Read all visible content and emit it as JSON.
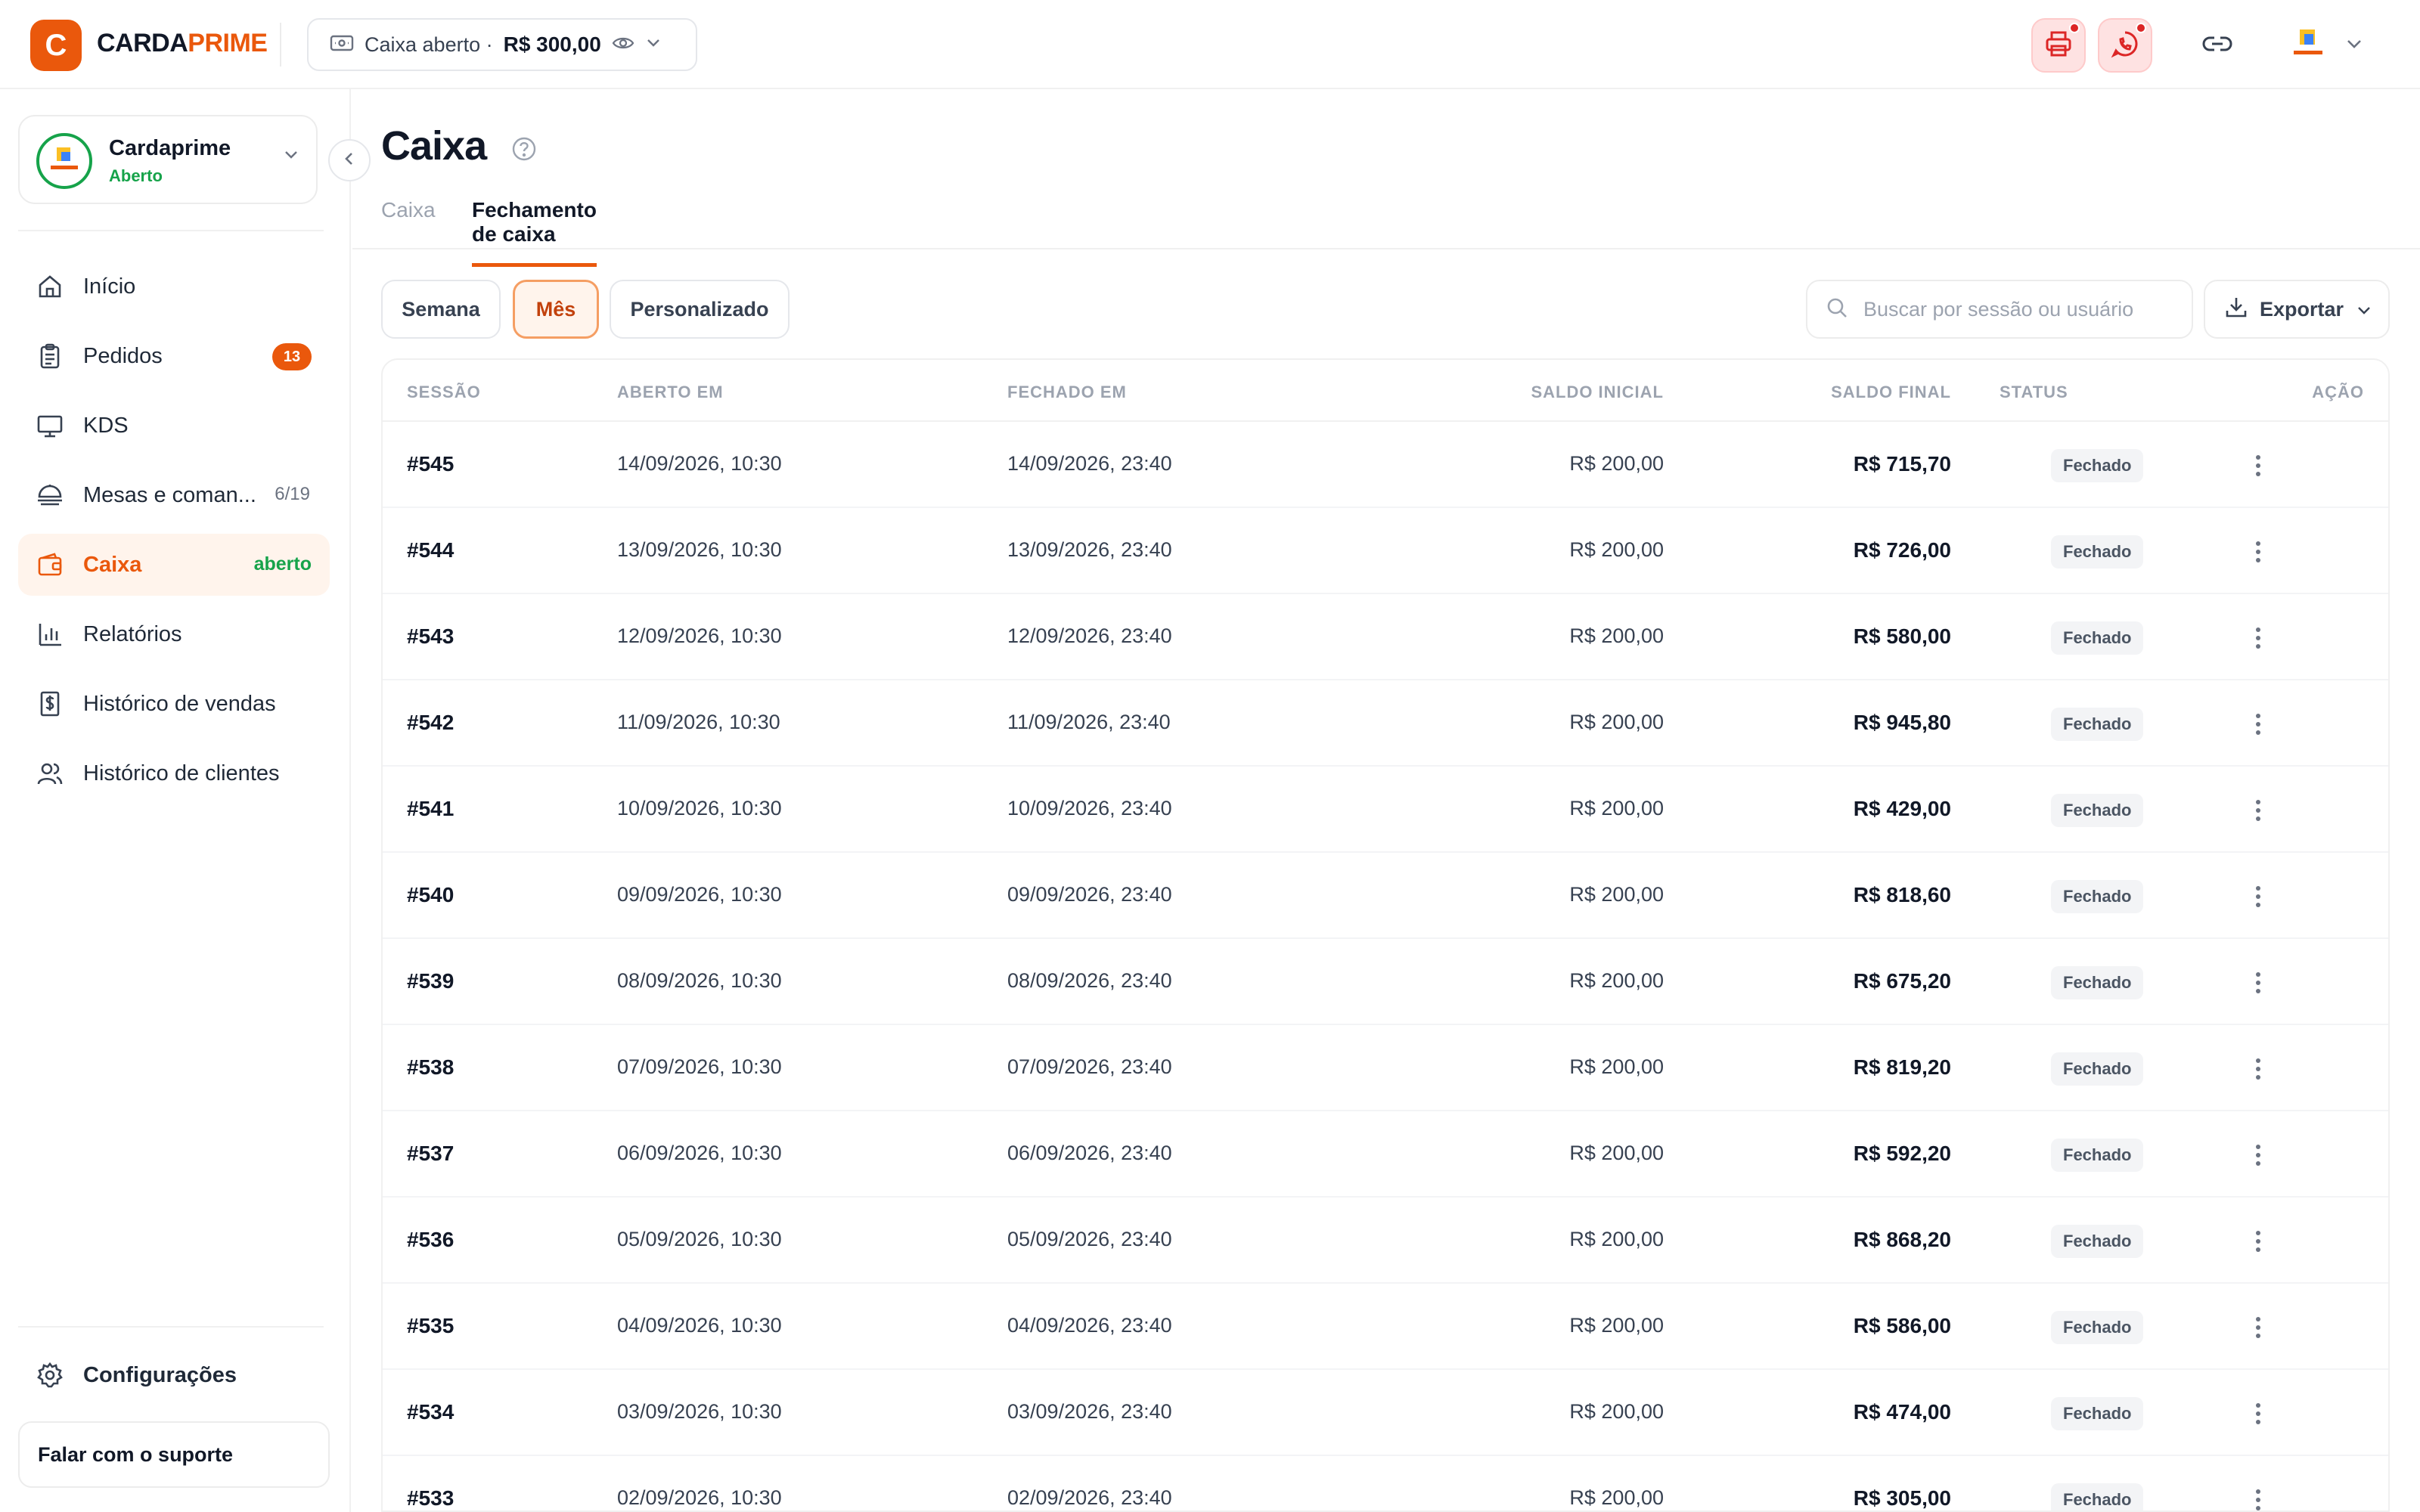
{
  "brand": {
    "mark": "C",
    "name_part1": "CARDA",
    "name_part2": "PRIME"
  },
  "cash_status": {
    "label": "Caixa aberto ·",
    "amount": "R$ 300,00"
  },
  "store": {
    "name": "Cardaprime",
    "status": "Aberto"
  },
  "nav": {
    "items": [
      {
        "label": "Início",
        "icon": "home-icon"
      },
      {
        "label": "Pedidos",
        "icon": "clipboard-icon",
        "badge": "13"
      },
      {
        "label": "KDS",
        "icon": "monitor-icon"
      },
      {
        "label": "Mesas e coman...",
        "icon": "dish-icon",
        "count": "6/19"
      },
      {
        "label": "Caixa",
        "icon": "wallet-icon",
        "tag": "aberto",
        "active": true
      },
      {
        "label": "Relatórios",
        "icon": "bar-chart-icon"
      },
      {
        "label": "Histórico de vendas",
        "icon": "receipt-dollar-icon"
      },
      {
        "label": "Histórico de clientes",
        "icon": "users-icon"
      }
    ],
    "settings": "Configurações",
    "support": "Falar com o suporte"
  },
  "page": {
    "title": "Caixa",
    "tabs": [
      "Caixa",
      "Fechamento de caixa"
    ],
    "active_tab": "Fechamento de caixa"
  },
  "filters": {
    "periods": [
      "Semana",
      "Mês",
      "Personalizado"
    ],
    "active_period": "Mês",
    "search_placeholder": "Buscar por sessão ou usuário",
    "export_label": "Exportar"
  },
  "table": {
    "headers": {
      "session": "SESSÃO",
      "opened": "ABERTO EM",
      "closed": "FECHADO EM",
      "initial": "SALDO INICIAL",
      "final": "SALDO FINAL",
      "status": "STATUS",
      "action": "AÇÃO"
    },
    "rows": [
      {
        "session": "#545",
        "opened": "14/09/2026, 10:30",
        "closed": "14/09/2026, 23:40",
        "initial": "R$ 200,00",
        "final": "R$ 715,70",
        "status": "Fechado"
      },
      {
        "session": "#544",
        "opened": "13/09/2026, 10:30",
        "closed": "13/09/2026, 23:40",
        "initial": "R$ 200,00",
        "final": "R$ 726,00",
        "status": "Fechado"
      },
      {
        "session": "#543",
        "opened": "12/09/2026, 10:30",
        "closed": "12/09/2026, 23:40",
        "initial": "R$ 200,00",
        "final": "R$ 580,00",
        "status": "Fechado"
      },
      {
        "session": "#542",
        "opened": "11/09/2026, 10:30",
        "closed": "11/09/2026, 23:40",
        "initial": "R$ 200,00",
        "final": "R$ 945,80",
        "status": "Fechado"
      },
      {
        "session": "#541",
        "opened": "10/09/2026, 10:30",
        "closed": "10/09/2026, 23:40",
        "initial": "R$ 200,00",
        "final": "R$ 429,00",
        "status": "Fechado"
      },
      {
        "session": "#540",
        "opened": "09/09/2026, 10:30",
        "closed": "09/09/2026, 23:40",
        "initial": "R$ 200,00",
        "final": "R$ 818,60",
        "status": "Fechado"
      },
      {
        "session": "#539",
        "opened": "08/09/2026, 10:30",
        "closed": "08/09/2026, 23:40",
        "initial": "R$ 200,00",
        "final": "R$ 675,20",
        "status": "Fechado"
      },
      {
        "session": "#538",
        "opened": "07/09/2026, 10:30",
        "closed": "07/09/2026, 23:40",
        "initial": "R$ 200,00",
        "final": "R$ 819,20",
        "status": "Fechado"
      },
      {
        "session": "#537",
        "opened": "06/09/2026, 10:30",
        "closed": "06/09/2026, 23:40",
        "initial": "R$ 200,00",
        "final": "R$ 592,20",
        "status": "Fechado"
      },
      {
        "session": "#536",
        "opened": "05/09/2026, 10:30",
        "closed": "05/09/2026, 23:40",
        "initial": "R$ 200,00",
        "final": "R$ 868,20",
        "status": "Fechado"
      },
      {
        "session": "#535",
        "opened": "04/09/2026, 10:30",
        "closed": "04/09/2026, 23:40",
        "initial": "R$ 200,00",
        "final": "R$ 586,00",
        "status": "Fechado"
      },
      {
        "session": "#534",
        "opened": "03/09/2026, 10:30",
        "closed": "03/09/2026, 23:40",
        "initial": "R$ 200,00",
        "final": "R$ 474,00",
        "status": "Fechado"
      },
      {
        "session": "#533",
        "opened": "02/09/2026, 10:30",
        "closed": "02/09/2026, 23:40",
        "initial": "R$ 200,00",
        "final": "R$ 305,00",
        "status": "Fechado"
      }
    ]
  },
  "colors": {
    "accent": "#ea580c",
    "success": "#16a34a",
    "danger": "#dc2626"
  }
}
